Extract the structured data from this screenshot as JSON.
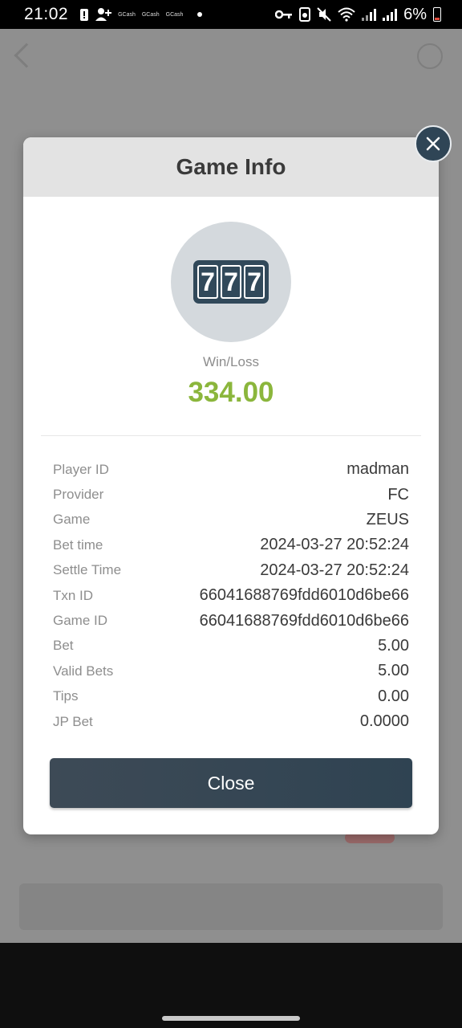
{
  "status_bar": {
    "time": "21:02",
    "notification_labels": [
      "GCash",
      "GCash",
      "GCash"
    ],
    "battery_percent": "6%"
  },
  "modal": {
    "title": "Game Info",
    "game_icon_digits": [
      "7",
      "7",
      "7"
    ],
    "win_loss_label": "Win/Loss",
    "win_loss_value": "334.00",
    "win_loss_color": "#8bb63c",
    "details": [
      {
        "label": "Player ID",
        "value": "madman"
      },
      {
        "label": "Provider",
        "value": "FC"
      },
      {
        "label": "Game",
        "value": "ZEUS"
      },
      {
        "label": "Bet time",
        "value": "2024-03-27 20:52:24"
      },
      {
        "label": "Settle Time",
        "value": "2024-03-27 20:52:24"
      },
      {
        "label": "Txn ID",
        "value": "66041688769fdd6010d6be66"
      },
      {
        "label": "Game ID",
        "value": "66041688769fdd6010d6be66"
      },
      {
        "label": "Bet",
        "value": "5.00"
      },
      {
        "label": "Valid Bets",
        "value": "5.00"
      },
      {
        "label": "Tips",
        "value": "0.00"
      },
      {
        "label": "JP Bet",
        "value": "0.0000"
      }
    ],
    "close_button_label": "Close",
    "accent_color": "#2f4556"
  }
}
